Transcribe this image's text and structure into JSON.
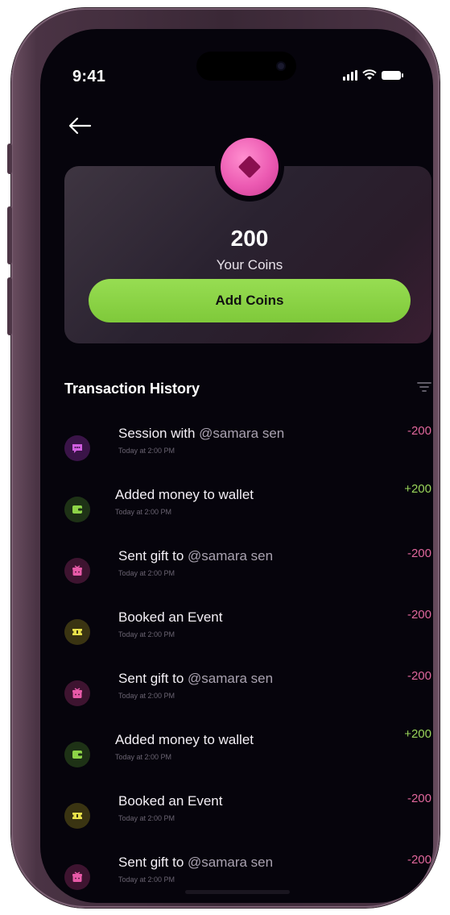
{
  "status_bar": {
    "time": "9:41"
  },
  "wallet": {
    "amount": "200",
    "label": "Your Coins",
    "add_button": "Add Coins"
  },
  "history": {
    "title": "Transaction History",
    "items": [
      {
        "icon": "chat-icon",
        "text": "Session with ",
        "handle": "@samara sen",
        "time": "Today at 2:00 PM",
        "amount": "-200",
        "type": "debit"
      },
      {
        "icon": "wallet-icon",
        "text": "Added money to wallet",
        "handle": "",
        "time": "Today at 2:00 PM",
        "amount": "+200",
        "type": "credit"
      },
      {
        "icon": "gift-icon",
        "text": "Sent gift to ",
        "handle": "@samara sen",
        "time": "Today at 2:00 PM",
        "amount": "-200",
        "type": "debit"
      },
      {
        "icon": "ticket-icon",
        "text": "Booked an Event",
        "handle": "",
        "time": "Today at 2:00 PM",
        "amount": "-200",
        "type": "debit"
      },
      {
        "icon": "gift-icon",
        "text": "Sent gift to ",
        "handle": "@samara sen",
        "time": "Today at 2:00 PM",
        "amount": "-200",
        "type": "debit"
      },
      {
        "icon": "wallet-icon",
        "text": "Added money to wallet",
        "handle": "",
        "time": "Today at 2:00 PM",
        "amount": "+200",
        "type": "credit"
      },
      {
        "icon": "ticket-icon",
        "text": "Booked an Event",
        "handle": "",
        "time": "Today at 2:00 PM",
        "amount": "-200",
        "type": "debit"
      },
      {
        "icon": "gift-icon",
        "text": "Sent gift to ",
        "handle": "@samara sen",
        "time": "Today at 2:00 PM",
        "amount": "-200",
        "type": "debit"
      }
    ]
  },
  "colors": {
    "accent_green": "#8ed447",
    "accent_pink": "#ec5ab2",
    "debit": "#e0679c",
    "credit": "#9ad65a",
    "background": "#06040c"
  }
}
